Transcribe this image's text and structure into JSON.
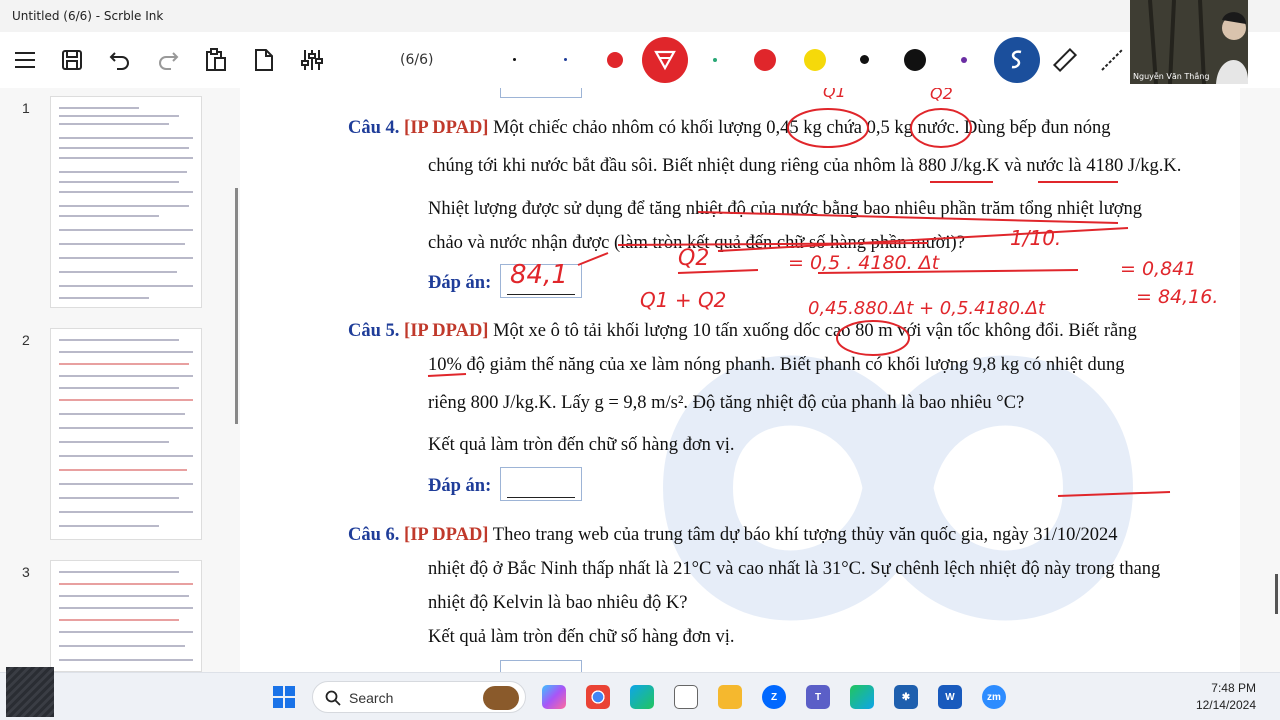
{
  "window": {
    "title": "Untitled (6/6) - Scrble Ink"
  },
  "toolbar": {
    "page_indicator": "(6/6)",
    "icons": [
      "menu-icon",
      "save-icon",
      "undo-icon",
      "redo-icon",
      "clipboard-icon",
      "page-icon",
      "sliders-icon"
    ],
    "pen_colors": [
      "#111111",
      "#1f3d99",
      "#e0262b",
      "#2aa876",
      "#e0262b",
      "#f5d90a",
      "#111111",
      "#111111",
      "#6a2ea3"
    ],
    "highlighter_color": "#e0262b",
    "active_tool_color": "#1b4f9c"
  },
  "webcam": {
    "name": "Nguyễn Văn Thắng"
  },
  "sidebar": {
    "pages": [
      "1",
      "2",
      "3"
    ]
  },
  "document": {
    "q4": {
      "label": "Câu 4.",
      "tag": "[IP DPAD]",
      "line1": "Một chiếc chảo nhôm có khối lượng 0,45 kg chứa 0,5 kg nước. Dùng bếp đun nóng",
      "line2": "chúng tới khi nước bắt đầu sôi. Biết nhiệt dung riêng của nhôm là 880 J/kg.K và nước là 4180 J/kg.K.",
      "line3": "Nhiệt lượng được sử dụng để tăng nhiệt độ của nước bằng bao nhiêu phần trăm tổng nhiệt lượng",
      "line4": "chảo và nước nhận được (làm tròn kết quả đến chữ số hàng phần mười)?",
      "answer_label": "Đáp án:",
      "answer_ink": "84,1"
    },
    "q5": {
      "label": "Câu 5.",
      "tag": "[IP DPAD]",
      "line1": "Một xe ô tô tải khối lượng 10 tấn xuống dốc cao 80 m với vận tốc không đổi. Biết rằng",
      "line2": "10% độ giảm thế năng của xe làm nóng phanh. Biết phanh có khối lượng 9,8 kg có nhiệt dung",
      "line3": "riêng 800 J/kg.K. Lấy g = 9,8 m/s². Độ tăng nhiệt độ của phanh là bao nhiêu °C?",
      "line4": "Kết quả làm tròn đến chữ số hàng đơn vị.",
      "answer_label": "Đáp án:"
    },
    "q6": {
      "label": "Câu 6.",
      "tag": "[IP DPAD]",
      "line1": "Theo trang web của trung tâm dự báo khí tượng thủy văn quốc gia, ngày 31/10/2024",
      "line2": "nhiệt độ ở Bắc Ninh thấp nhất là 21°C và cao nhất là 31°C. Sự chênh lệch nhiệt độ này trong thang",
      "line3": "nhiệt độ Kelvin là bao nhiêu độ K?",
      "line4": "Kết quả làm tròn đến chữ số hàng đơn vị."
    },
    "ink": {
      "q1": "Q1",
      "q2": "Q2",
      "frac": "1/10.",
      "eq1": "= 0,5 . 4180. Δt",
      "r1": "= 0,841",
      "sum": "Q1 + Q2",
      "eq2": "0,45.880.Δt + 0,5.4180.Δt",
      "r2": "= 84,16."
    }
  },
  "taskbar": {
    "search_placeholder": "Search",
    "time": "7:48 PM",
    "date": "12/14/2024",
    "apps": [
      "start-icon",
      "copilot-icon",
      "chrome-icon",
      "edge-icon",
      "file-icon",
      "folder-icon",
      "zalo-icon",
      "teams-icon",
      "edge-dev-icon",
      "snipping-icon",
      "word-icon",
      "zoom-icon"
    ]
  }
}
